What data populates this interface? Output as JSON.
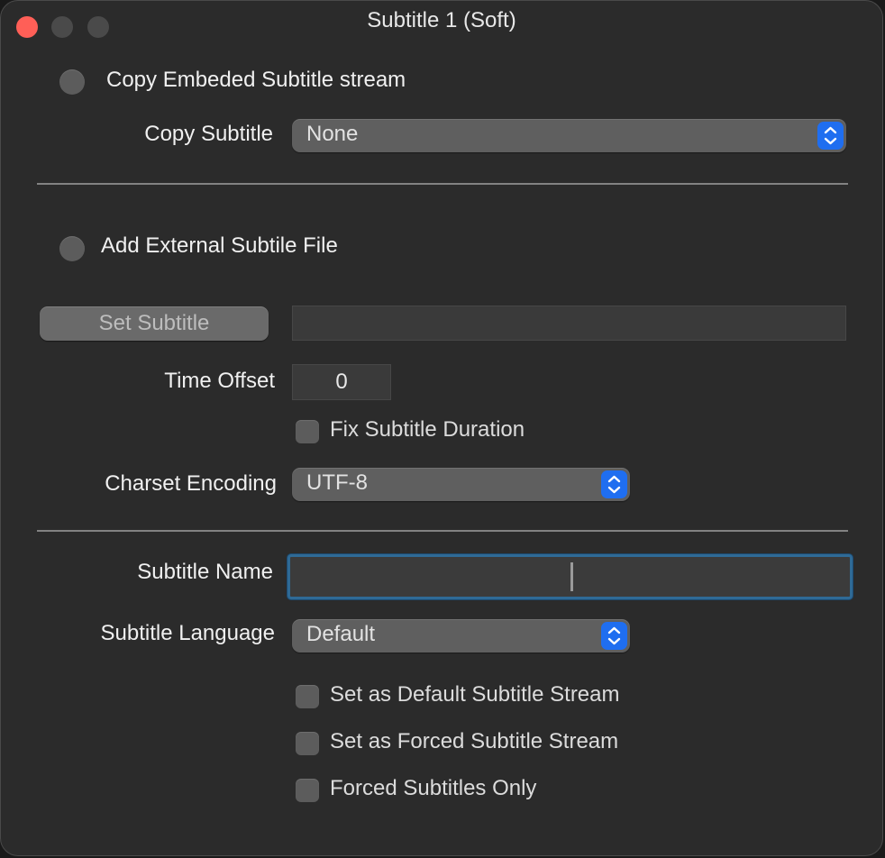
{
  "window": {
    "title": "Subtitle 1 (Soft)"
  },
  "copy_section": {
    "radio_label": "Copy Embeded Subtitle stream",
    "copy_subtitle_label": "Copy Subtitle",
    "copy_subtitle_value": "None"
  },
  "external_section": {
    "radio_label": "Add External Subtile File",
    "set_subtitle_button": "Set Subtitle",
    "file_path_value": "",
    "time_offset_label": "Time Offset",
    "time_offset_value": "0",
    "fix_duration_label": "Fix Subtitle Duration",
    "charset_label": "Charset Encoding",
    "charset_value": "UTF-8"
  },
  "metadata_section": {
    "subtitle_name_label": "Subtitle Name",
    "subtitle_name_value": "",
    "subtitle_language_label": "Subtitle Language",
    "subtitle_language_value": "Default",
    "default_stream_label": "Set as Default Subtitle Stream",
    "forced_stream_label": "Set as Forced Subtitle Stream",
    "forced_only_label": "Forced Subtitles Only"
  },
  "colors": {
    "window_bg": "#2b2b2b",
    "accent_blue": "#1f6ef0",
    "close_red": "#ff5f57",
    "focus_ring": "#2f6a96"
  }
}
